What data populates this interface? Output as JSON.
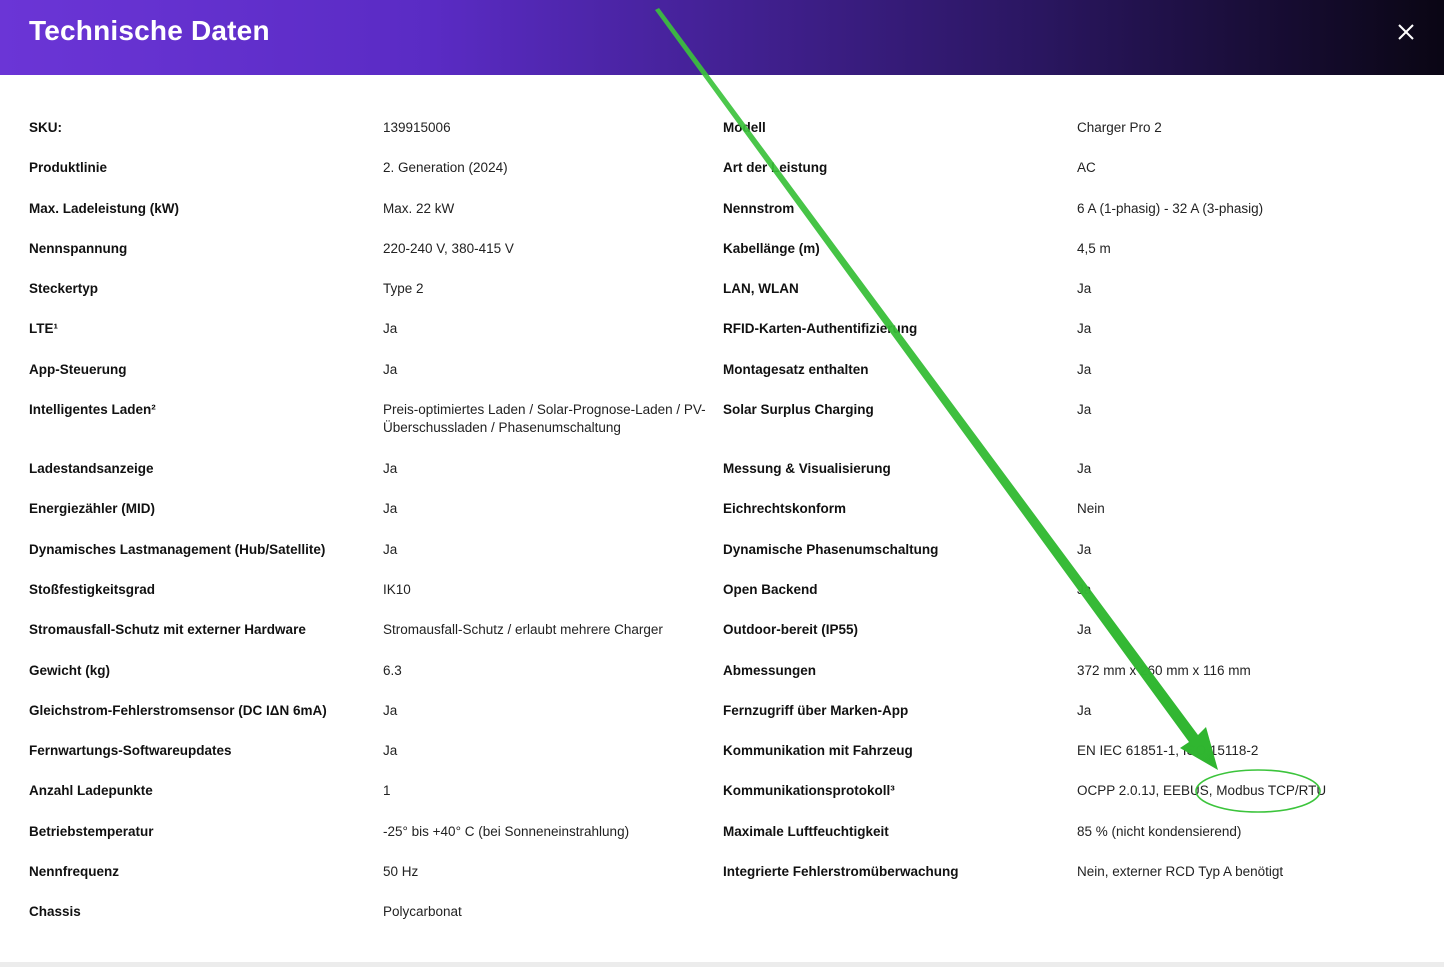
{
  "modal": {
    "title": "Technische Daten"
  },
  "rows": [
    {
      "l1": "SKU:",
      "v1": "139915006",
      "l2": "Modell",
      "v2": "Charger Pro 2"
    },
    {
      "l1": "Produktlinie",
      "v1": "2. Generation (2024)",
      "l2": "Art der Leistung",
      "v2": "AC"
    },
    {
      "l1": "Max. Ladeleistung (kW)",
      "v1": "Max. 22 kW",
      "l2": "Nennstrom",
      "v2": "6 A (1-phasig) - 32 A (3-phasig)"
    },
    {
      "l1": "Nennspannung",
      "v1": "220-240 V, 380-415 V",
      "l2": "Kabellänge (m)",
      "v2": "4,5 m"
    },
    {
      "l1": "Steckertyp",
      "v1": "Type 2",
      "l2": "LAN, WLAN",
      "v2": "Ja"
    },
    {
      "l1": "LTE¹",
      "v1": "Ja",
      "l2": "RFID-Karten-Authentifizierung",
      "v2": "Ja"
    },
    {
      "l1": "App-Steuerung",
      "v1": "Ja",
      "l2": "Montagesatz enthalten",
      "v2": "Ja"
    },
    {
      "l1": "Intelligentes Laden²",
      "v1": "Preis-optimiertes Laden / Solar-Prognose-Laden / PV-Überschussladen / Phasenumschaltung",
      "l2": "Solar Surplus Charging",
      "v2": "Ja"
    },
    {
      "l1": "Ladestandsanzeige",
      "v1": "Ja",
      "l2": "Messung & Visualisierung",
      "v2": "Ja"
    },
    {
      "l1": "Energiezähler (MID)",
      "v1": "Ja",
      "l2": "Eichrechtskonform",
      "v2": "Nein"
    },
    {
      "l1": "Dynamisches Lastmanagement (Hub/Satellite)",
      "v1": "Ja",
      "l2": "Dynamische Phasenumschaltung",
      "v2": "Ja"
    },
    {
      "l1": "Stoßfestigkeitsgrad",
      "v1": "IK10",
      "l2": "Open Backend",
      "v2": "Ja"
    },
    {
      "l1": "Stromausfall-Schutz mit externer Hardware",
      "v1": "Stromausfall-Schutz / erlaubt mehrere Charger",
      "l2": "Outdoor-bereit (IP55)",
      "v2": "Ja"
    },
    {
      "l1": "Gewicht (kg)",
      "v1": "6.3",
      "l2": "Abmessungen",
      "v2": "372 mm x 260 mm x 116 mm"
    },
    {
      "l1": "Gleichstrom-Fehlerstromsensor (DC IΔN 6mA)",
      "v1": "Ja",
      "l2": "Fernzugriff über Marken-App",
      "v2": "Ja"
    },
    {
      "l1": "Fernwartungs-Softwareupdates",
      "v1": "Ja",
      "l2": "Kommunikation mit Fahrzeug",
      "v2": "EN IEC 61851-1, ISO 15118-2"
    },
    {
      "l1": "Anzahl Ladepunkte",
      "v1": "1",
      "l2": "Kommunikationsprotokoll³",
      "v2": "OCPP 2.0.1J, EEBUS, Modbus TCP/RTU"
    },
    {
      "l1": "Betriebstemperatur",
      "v1": "-25° bis +40° C (bei Sonneneinstrahlung)",
      "l2": "Maximale Luftfeuchtigkeit",
      "v2": "85 % (nicht kondensierend)"
    },
    {
      "l1": "Nennfrequenz",
      "v1": "50 Hz",
      "l2": "Integrierte Fehlerstromüberwachung",
      "v2": "Nein, externer RCD Typ A benötigt"
    },
    {
      "l1": "Chassis",
      "v1": "Polycarbonat",
      "l2": "",
      "v2": ""
    }
  ],
  "colors": {
    "header_start": "#6b35d6",
    "header_end": "#0a0614",
    "annotation_green": "#3cc43c"
  },
  "icons": {
    "close": "close-icon"
  }
}
